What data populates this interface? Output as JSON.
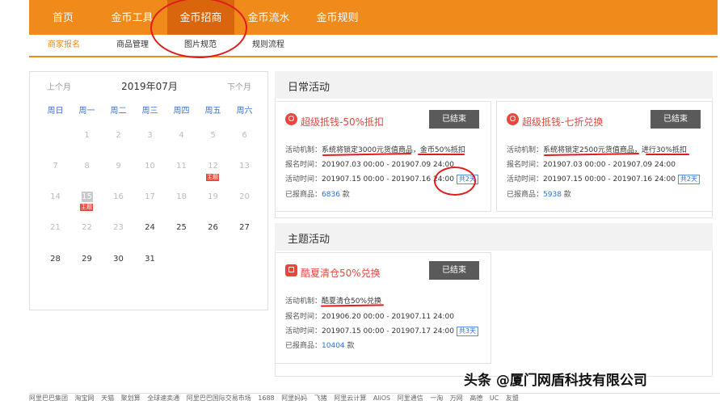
{
  "top_nav": [
    "首页",
    "金币工具",
    "金币招商",
    "金币流水",
    "金币规则"
  ],
  "top_nav_active": "金币招商",
  "sub_nav": [
    "商家报名",
    "商品管理",
    "图片规范",
    "规则流程"
  ],
  "sub_nav_active": "商家报名",
  "calendar": {
    "prev": "上个月",
    "next": "下个月",
    "title": "2019年07月",
    "weekdays": [
      "周日",
      "周一",
      "周二",
      "周三",
      "周四",
      "周五",
      "周六"
    ],
    "today": "15",
    "theme_badge": "主题",
    "rows": [
      [
        "",
        "1",
        "2",
        "3",
        "4",
        "5",
        "6"
      ],
      [
        "7",
        "8",
        "9",
        "10",
        "11",
        "12",
        "13"
      ],
      [
        "14",
        "15",
        "16",
        "17",
        "18",
        "19",
        "20"
      ],
      [
        "21",
        "22",
        "23",
        "24",
        "25",
        "26",
        "27"
      ],
      [
        "28",
        "29",
        "30",
        "31",
        "",
        "",
        ""
      ]
    ]
  },
  "daily": {
    "title": "日常活动",
    "cards": [
      {
        "title": "超级抵钱-50%抵扣",
        "status": "已结束",
        "mechanism_label": "活动机制：",
        "mechanism": "系统将锁定3000元货值商品，金币50%抵扣",
        "signup_label": "报名时间：",
        "signup": "201907.03 00:00 - 201907.09 24:00",
        "activity_label": "活动时间：",
        "activity": "201907.15 00:00 - 201907.16 24:00",
        "days": "共2天",
        "count_label": "已报商品：",
        "count": "6836",
        "count_unit": "款"
      },
      {
        "title": "超级抵钱-七折兑换",
        "status": "已结束",
        "mechanism_label": "活动机制：",
        "mechanism": "系统将锁定2500元货值商品，进行30%抵扣",
        "signup_label": "报名时间：",
        "signup": "201907.03 00:00 - 201907.09 24:00",
        "activity_label": "活动时间：",
        "activity": "201907.15 00:00 - 201907.16 24:00",
        "days": "共2天",
        "count_label": "已报商品：",
        "count": "5938",
        "count_unit": "款"
      }
    ]
  },
  "theme": {
    "title": "主题活动",
    "cards": [
      {
        "title": "酷夏清仓50%兑换",
        "status": "已结束",
        "mechanism_label": "活动机制：",
        "mechanism": "酷夏清仓50%兑换",
        "signup_label": "报名时间：",
        "signup": "201906.20 00:00 - 201907.11 24:00",
        "activity_label": "活动时间：",
        "activity": "201907.15 00:00 - 201907.17 24:00",
        "days": "共3天",
        "count_label": "已报商品：",
        "count": "10404",
        "count_unit": "款"
      }
    ]
  },
  "footer_links": [
    "阿里巴巴集团",
    "淘宝网",
    "天猫",
    "聚划算",
    "全球速卖通",
    "阿里巴巴国际交易市场",
    "1688",
    "阿里妈妈",
    "飞猪",
    "阿里云计算",
    "AliOS",
    "阿里通信",
    "一淘",
    "万网",
    "高德",
    "UC",
    "友盟"
  ],
  "watermark": "头条 @厦门网盾科技有限公司",
  "colors": {
    "brand": "#f08a1b",
    "brand_dark": "#d9650c",
    "accent_red": "#e8473d",
    "link_blue": "#2b6fd3",
    "annotation": "#e21b1b"
  }
}
